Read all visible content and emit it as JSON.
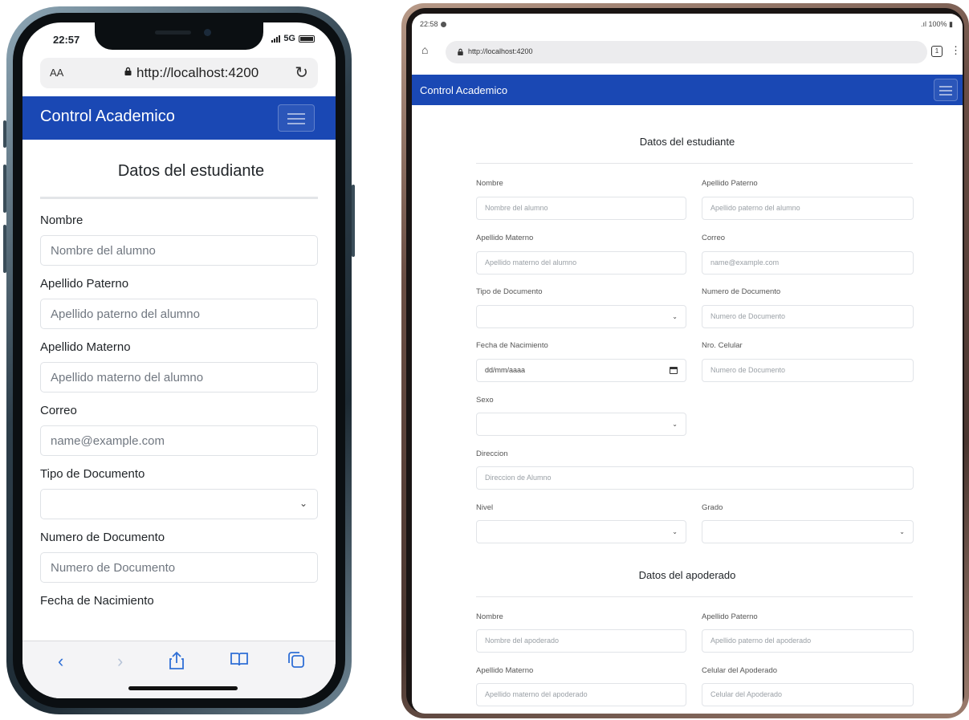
{
  "phone": {
    "status_time": "22:57",
    "status_network": "5G",
    "url_aa": "AA",
    "url": "http://localhost:4200",
    "brand": "Control Academico",
    "section_title": "Datos del estudiante",
    "fields": [
      {
        "label": "Nombre",
        "placeholder": "Nombre del alumno"
      },
      {
        "label": "Apellido Paterno",
        "placeholder": "Apellido paterno del alumno"
      },
      {
        "label": "Apellido Materno",
        "placeholder": "Apellido materno del alumno"
      },
      {
        "label": "Correo",
        "placeholder": "name@example.com"
      },
      {
        "label": "Tipo de Documento",
        "placeholder": ""
      },
      {
        "label": "Numero de Documento",
        "placeholder": "Numero de Documento"
      }
    ],
    "cut_label": "Fecha de Nacimiento"
  },
  "tablet": {
    "status_time": "22:58",
    "status_right": "100%",
    "url": "http://localhost:4200",
    "tabs_count": "1",
    "brand": "Control Academico",
    "student_title": "Datos del estudiante",
    "student_fields": {
      "nombre": {
        "label": "Nombre",
        "placeholder": "Nombre del alumno"
      },
      "apellido_paterno": {
        "label": "Apellido Paterno",
        "placeholder": "Apellido paterno del alumno"
      },
      "apellido_materno": {
        "label": "Apellido Materno",
        "placeholder": "Apellido materno del alumno"
      },
      "correo": {
        "label": "Correo",
        "placeholder": "name@example.com"
      },
      "tipo_documento": {
        "label": "Tipo de Documento",
        "placeholder": ""
      },
      "numero_documento": {
        "label": "Numero de Documento",
        "placeholder": "Numero de Documento"
      },
      "fecha_nacimiento": {
        "label": "Fecha de Nacimiento",
        "placeholder": "dd/mm/aaaa"
      },
      "celular": {
        "label": "Nro. Celular",
        "placeholder": "Numero de Documento"
      },
      "sexo": {
        "label": "Sexo",
        "placeholder": ""
      },
      "direccion": {
        "label": "Direccion",
        "placeholder": "Direccion de Alumno"
      },
      "nivel": {
        "label": "Nivel",
        "placeholder": ""
      },
      "grado": {
        "label": "Grado",
        "placeholder": ""
      }
    },
    "guardian_title": "Datos del apoderado",
    "guardian_fields": {
      "nombre": {
        "label": "Nombre",
        "placeholder": "Nombre del apoderado"
      },
      "apellido_paterno": {
        "label": "Apellido Paterno",
        "placeholder": "Apellido paterno del apoderado"
      },
      "apellido_materno": {
        "label": "Apellido Materno",
        "placeholder": "Apellido materno del apoderado"
      },
      "celular": {
        "label": "Celular del Apoderado",
        "placeholder": "Celular del Apoderado"
      }
    }
  },
  "colors": {
    "navbar": "#1a48b4",
    "ios_accent": "#2f6fd6"
  }
}
